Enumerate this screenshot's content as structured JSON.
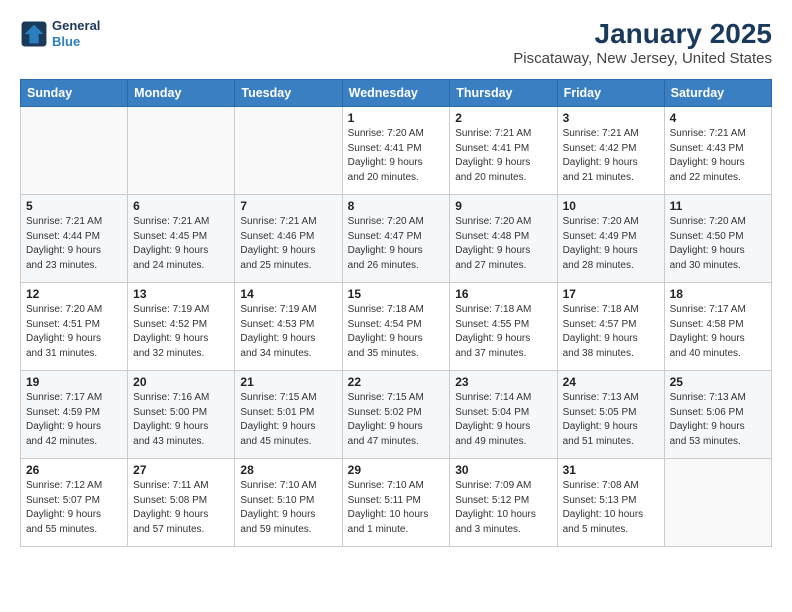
{
  "header": {
    "logo_line1": "General",
    "logo_line2": "Blue",
    "title": "January 2025",
    "subtitle": "Piscataway, New Jersey, United States"
  },
  "days_of_week": [
    "Sunday",
    "Monday",
    "Tuesday",
    "Wednesday",
    "Thursday",
    "Friday",
    "Saturday"
  ],
  "weeks": [
    [
      {
        "day": "",
        "info": ""
      },
      {
        "day": "",
        "info": ""
      },
      {
        "day": "",
        "info": ""
      },
      {
        "day": "1",
        "info": "Sunrise: 7:20 AM\nSunset: 4:41 PM\nDaylight: 9 hours\nand 20 minutes."
      },
      {
        "day": "2",
        "info": "Sunrise: 7:21 AM\nSunset: 4:41 PM\nDaylight: 9 hours\nand 20 minutes."
      },
      {
        "day": "3",
        "info": "Sunrise: 7:21 AM\nSunset: 4:42 PM\nDaylight: 9 hours\nand 21 minutes."
      },
      {
        "day": "4",
        "info": "Sunrise: 7:21 AM\nSunset: 4:43 PM\nDaylight: 9 hours\nand 22 minutes."
      }
    ],
    [
      {
        "day": "5",
        "info": "Sunrise: 7:21 AM\nSunset: 4:44 PM\nDaylight: 9 hours\nand 23 minutes."
      },
      {
        "day": "6",
        "info": "Sunrise: 7:21 AM\nSunset: 4:45 PM\nDaylight: 9 hours\nand 24 minutes."
      },
      {
        "day": "7",
        "info": "Sunrise: 7:21 AM\nSunset: 4:46 PM\nDaylight: 9 hours\nand 25 minutes."
      },
      {
        "day": "8",
        "info": "Sunrise: 7:20 AM\nSunset: 4:47 PM\nDaylight: 9 hours\nand 26 minutes."
      },
      {
        "day": "9",
        "info": "Sunrise: 7:20 AM\nSunset: 4:48 PM\nDaylight: 9 hours\nand 27 minutes."
      },
      {
        "day": "10",
        "info": "Sunrise: 7:20 AM\nSunset: 4:49 PM\nDaylight: 9 hours\nand 28 minutes."
      },
      {
        "day": "11",
        "info": "Sunrise: 7:20 AM\nSunset: 4:50 PM\nDaylight: 9 hours\nand 30 minutes."
      }
    ],
    [
      {
        "day": "12",
        "info": "Sunrise: 7:20 AM\nSunset: 4:51 PM\nDaylight: 9 hours\nand 31 minutes."
      },
      {
        "day": "13",
        "info": "Sunrise: 7:19 AM\nSunset: 4:52 PM\nDaylight: 9 hours\nand 32 minutes."
      },
      {
        "day": "14",
        "info": "Sunrise: 7:19 AM\nSunset: 4:53 PM\nDaylight: 9 hours\nand 34 minutes."
      },
      {
        "day": "15",
        "info": "Sunrise: 7:18 AM\nSunset: 4:54 PM\nDaylight: 9 hours\nand 35 minutes."
      },
      {
        "day": "16",
        "info": "Sunrise: 7:18 AM\nSunset: 4:55 PM\nDaylight: 9 hours\nand 37 minutes."
      },
      {
        "day": "17",
        "info": "Sunrise: 7:18 AM\nSunset: 4:57 PM\nDaylight: 9 hours\nand 38 minutes."
      },
      {
        "day": "18",
        "info": "Sunrise: 7:17 AM\nSunset: 4:58 PM\nDaylight: 9 hours\nand 40 minutes."
      }
    ],
    [
      {
        "day": "19",
        "info": "Sunrise: 7:17 AM\nSunset: 4:59 PM\nDaylight: 9 hours\nand 42 minutes."
      },
      {
        "day": "20",
        "info": "Sunrise: 7:16 AM\nSunset: 5:00 PM\nDaylight: 9 hours\nand 43 minutes."
      },
      {
        "day": "21",
        "info": "Sunrise: 7:15 AM\nSunset: 5:01 PM\nDaylight: 9 hours\nand 45 minutes."
      },
      {
        "day": "22",
        "info": "Sunrise: 7:15 AM\nSunset: 5:02 PM\nDaylight: 9 hours\nand 47 minutes."
      },
      {
        "day": "23",
        "info": "Sunrise: 7:14 AM\nSunset: 5:04 PM\nDaylight: 9 hours\nand 49 minutes."
      },
      {
        "day": "24",
        "info": "Sunrise: 7:13 AM\nSunset: 5:05 PM\nDaylight: 9 hours\nand 51 minutes."
      },
      {
        "day": "25",
        "info": "Sunrise: 7:13 AM\nSunset: 5:06 PM\nDaylight: 9 hours\nand 53 minutes."
      }
    ],
    [
      {
        "day": "26",
        "info": "Sunrise: 7:12 AM\nSunset: 5:07 PM\nDaylight: 9 hours\nand 55 minutes."
      },
      {
        "day": "27",
        "info": "Sunrise: 7:11 AM\nSunset: 5:08 PM\nDaylight: 9 hours\nand 57 minutes."
      },
      {
        "day": "28",
        "info": "Sunrise: 7:10 AM\nSunset: 5:10 PM\nDaylight: 9 hours\nand 59 minutes."
      },
      {
        "day": "29",
        "info": "Sunrise: 7:10 AM\nSunset: 5:11 PM\nDaylight: 10 hours\nand 1 minute."
      },
      {
        "day": "30",
        "info": "Sunrise: 7:09 AM\nSunset: 5:12 PM\nDaylight: 10 hours\nand 3 minutes."
      },
      {
        "day": "31",
        "info": "Sunrise: 7:08 AM\nSunset: 5:13 PM\nDaylight: 10 hours\nand 5 minutes."
      },
      {
        "day": "",
        "info": ""
      }
    ]
  ]
}
